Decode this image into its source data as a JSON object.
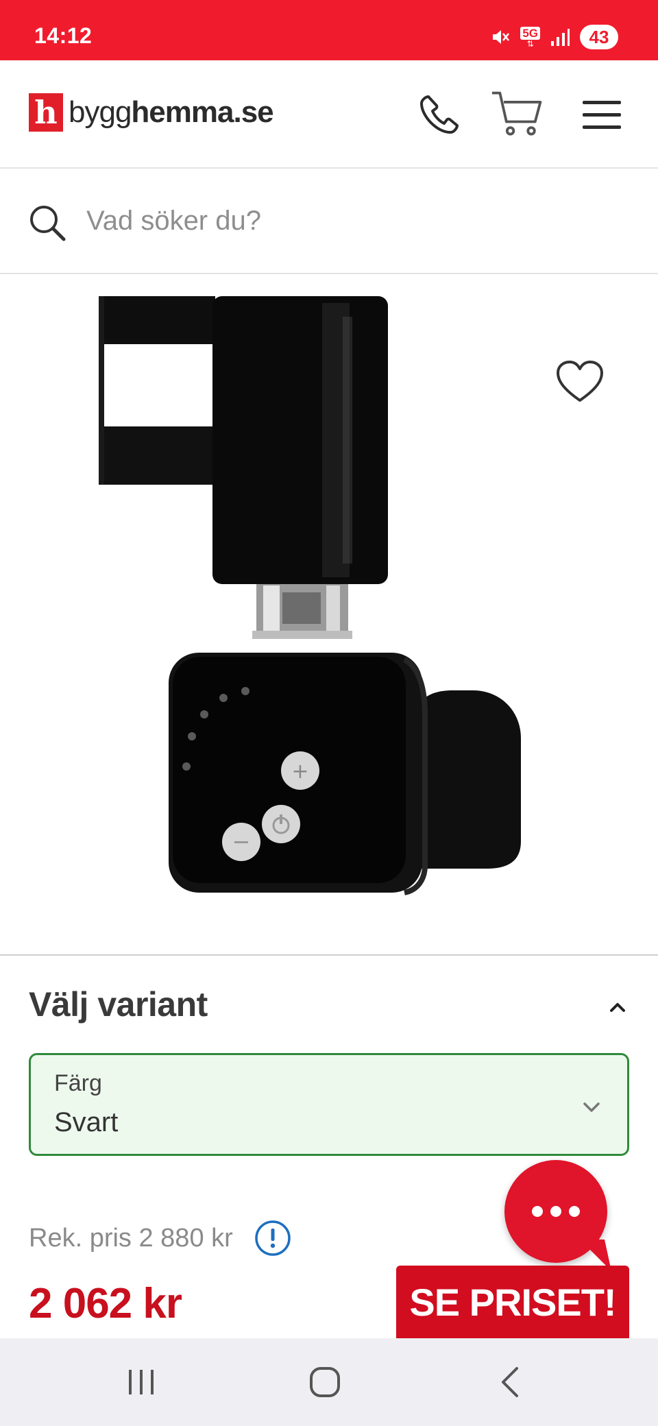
{
  "status_bar": {
    "time": "14:12",
    "network": "5G",
    "battery": "43"
  },
  "header": {
    "logo_mark": "h",
    "logo_text_thin": "bygg",
    "logo_text_bold": "hemma.se"
  },
  "search": {
    "placeholder": "Vad söker du?"
  },
  "variant": {
    "title": "Välj variant",
    "select_label": "Färg",
    "select_value": "Svart"
  },
  "pricing": {
    "recommended": "Rek. pris 2 880 kr",
    "price": "2 062 kr"
  },
  "promo": {
    "banner": "SE PRISET!"
  },
  "colors": {
    "brand_red": "#f01c2e",
    "price_red": "#c8101e",
    "select_green": "#2f8a3a"
  }
}
